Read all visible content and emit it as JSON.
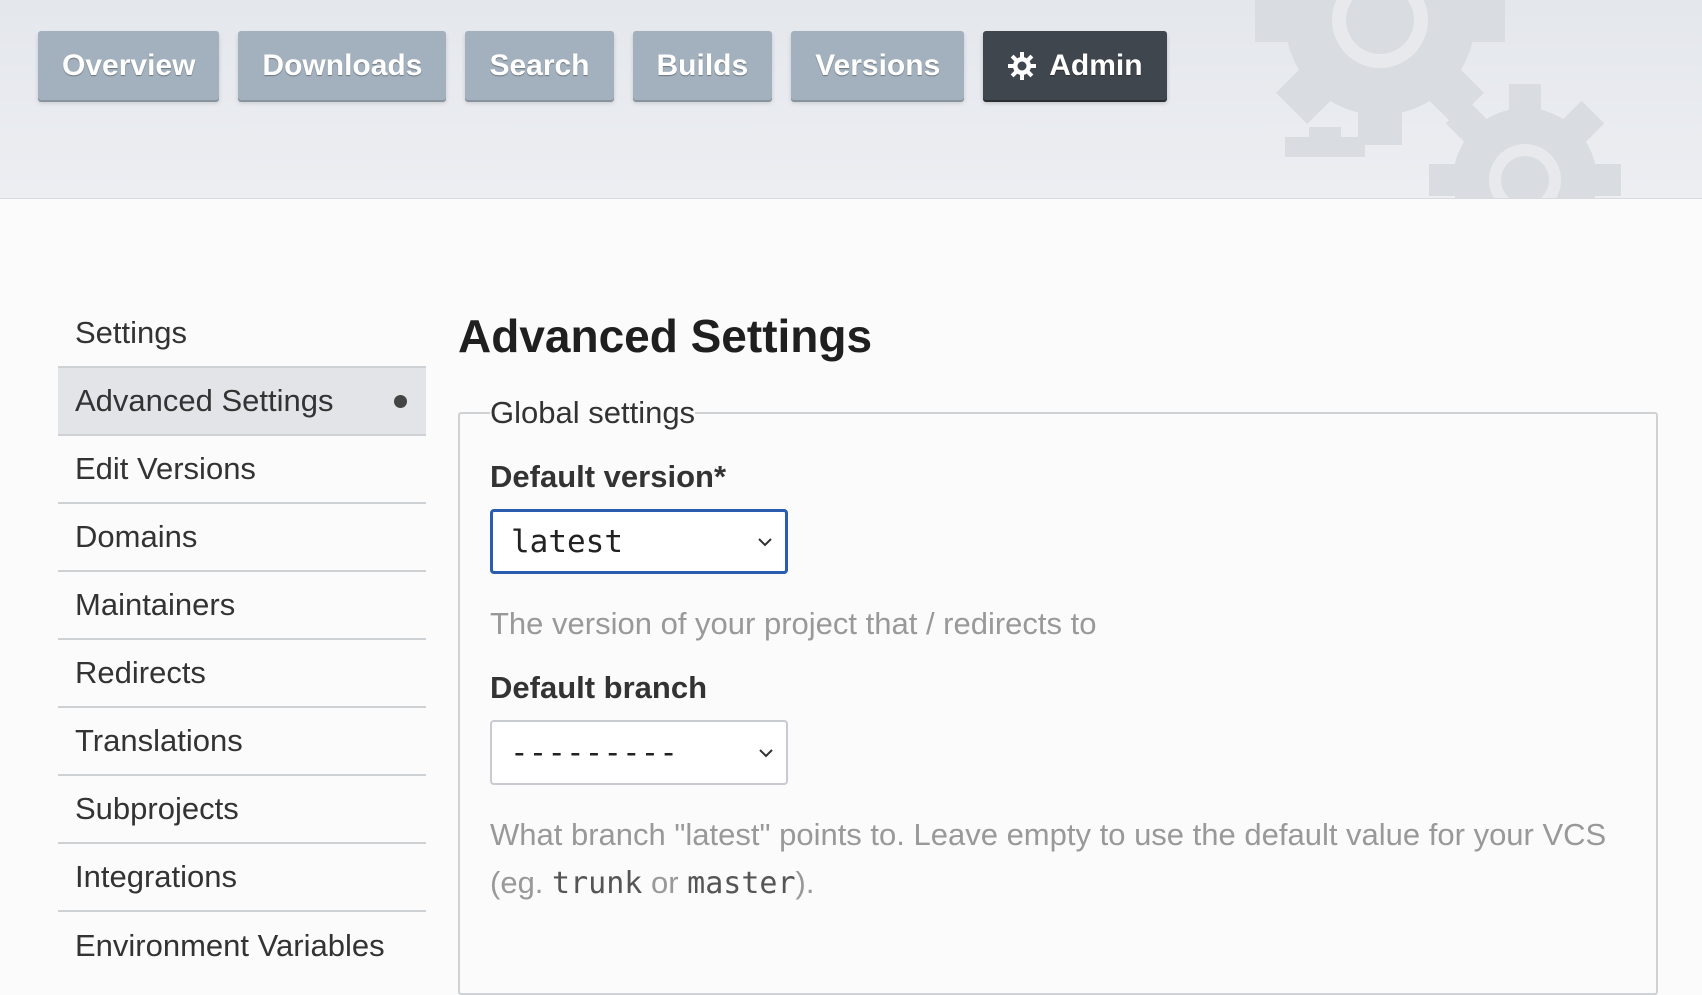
{
  "nav": {
    "items": [
      "Overview",
      "Downloads",
      "Search",
      "Builds",
      "Versions"
    ],
    "admin_label": "Admin"
  },
  "sidebar": {
    "items": [
      "Settings",
      "Advanced Settings",
      "Edit Versions",
      "Domains",
      "Maintainers",
      "Redirects",
      "Translations",
      "Subprojects",
      "Integrations",
      "Environment Variables"
    ],
    "active_index": 1
  },
  "main": {
    "title": "Advanced Settings",
    "legend": "Global settings",
    "default_version": {
      "label": "Default version*",
      "value": "latest",
      "help": "The version of your project that / redirects to"
    },
    "default_branch": {
      "label": "Default branch",
      "value": "---------",
      "help_prefix": "What branch \"latest\" points to. Leave empty to use the default value for your VCS (eg. ",
      "help_code1": "trunk",
      "help_mid": " or ",
      "help_code2": "master",
      "help_suffix": ")."
    }
  },
  "colors": {
    "nav_button": "#a3b1be",
    "nav_active": "#40464d",
    "focus_border": "#2a5db0"
  }
}
